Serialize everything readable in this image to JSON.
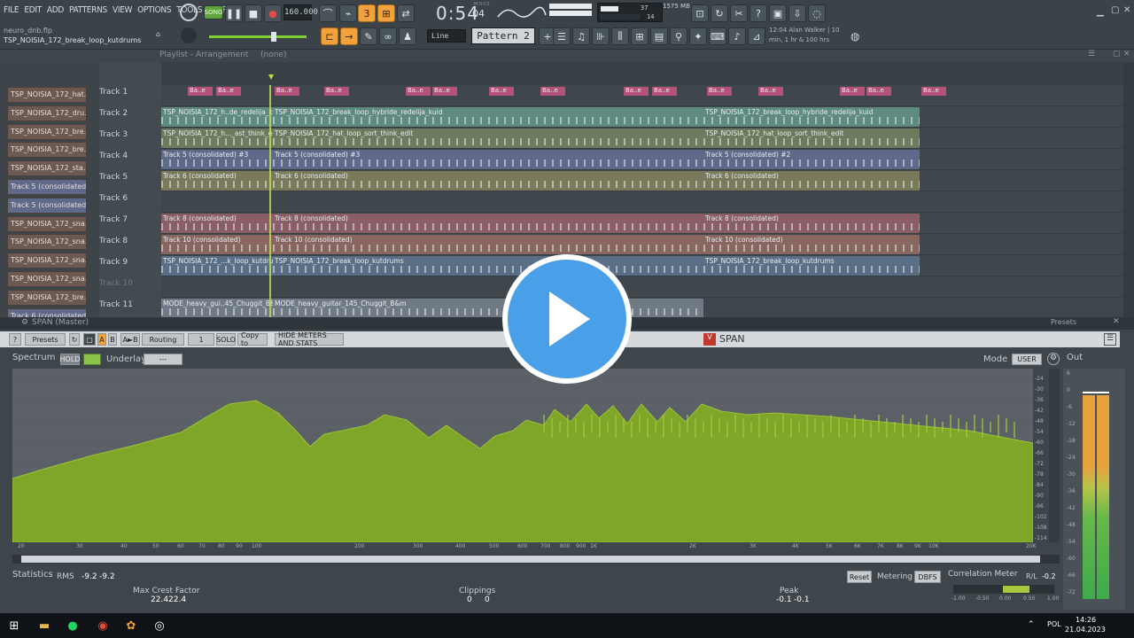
{
  "menu": [
    "FILE",
    "EDIT",
    "ADD",
    "PATTERNS",
    "VIEW",
    "OPTIONS",
    "TOOLS",
    "HELP"
  ],
  "transport": {
    "mode": "SONG",
    "tempo": "160.000",
    "time": "0:54",
    "time_sub": "04",
    "time_unit": "M:S:CS",
    "cpu": "37",
    "mem": "1575 MB",
    "voices": "14"
  },
  "project": {
    "file": "neuro_dnb.flp",
    "pattern_name": "TSP_NOISIA_172_break_loop_kutdrums",
    "snap": "Line",
    "pattern": "Pattern 2"
  },
  "hint": {
    "line1": "12:04  Alan Walker | 10",
    "line2": "min, 1 hr & 100 hrs"
  },
  "playlist": {
    "title": "Playlist - Arrangement",
    "arrangement": "(none)",
    "patterns": [
      "TSP_NOISIA_172_hat..",
      "TSP_NOISIA_172_dru..",
      "TSP_NOISIA_172_bre..",
      "TSP_NOISIA_172_bre..",
      "TSP_NOISIA_172_sta..",
      "Track 5 (consolidated)",
      "Track 5 (consolidated)",
      "TSP_NOISIA_172_sna..",
      "TSP_NOISIA_172_sna..",
      "TSP_NOISIA_172_sna..",
      "TSP_NOISIA_172_sna..",
      "TSP_NOISIA_172_bre..",
      "Track 6 (consolidated)"
    ],
    "tracks": [
      "Track 1",
      "Track 2",
      "Track 3",
      "Track 4",
      "Track 5",
      "Track 6",
      "Track 7",
      "Track 8",
      "Track 9",
      "Track 10",
      "Track 11"
    ],
    "clips": {
      "t1": "Ba..e",
      "t2": [
        "TSP_NOISIA_172_h..de_redelija_kuid",
        "TSP_NOISIA_172_break_loop_hybride_redelija_kuid",
        "TSP_NOISIA_172_break_loop_hybride_redelija_kuid"
      ],
      "t3": [
        "TSP_NOISIA_172_h..._ast_think_edit",
        "TSP_NOISIA_172_hat_loop_sort_think_edit",
        "TSP_NOISIA_172_hat_loop_sort_think_edit"
      ],
      "t4": [
        "Track 5 (consolidated) #3",
        "Track 5 (consolidated) #3",
        "Track 5 (consolidated) #2"
      ],
      "t5": [
        "Track 6 (consolidated)",
        "Track 6 (consolidated)",
        "Track 6 (consolidated)"
      ],
      "t7": [
        "Track 8 (consolidated)",
        "Track 8 (consolidated)",
        "Track 8 (consolidated)"
      ],
      "t8": [
        "Track 10 (consolidated)",
        "Track 10 (consolidated)",
        "Track 10 (consolidated)"
      ],
      "t9": [
        "TSP_NOISIA_172_...k_loop_kutdrums",
        "TSP_NOISIA_172_break_loop_kutdrums",
        "TSP_NOISIA_172_break_loop_kutdrums"
      ],
      "t11": [
        "MODE_heavy_gui..45_Chuggit_B&m",
        "MODE_heavy_guitar_145_Chuggit_B&m"
      ]
    }
  },
  "span": {
    "window_title": "SPAN (Master)",
    "presets": "Presets",
    "routing": "Routing",
    "channel": "1",
    "solo": "SOLO",
    "copy_to": "Copy to",
    "hide_meters": "HIDE METERS AND STATS",
    "logo": "SPAN",
    "spectrum": "Spectrum",
    "hold": "HOLD",
    "underlay": "Underlay",
    "underlay_value": "---",
    "mode": "Mode",
    "mode_value": "USER",
    "out": "Out",
    "db_ticks": [
      "-24",
      "-30",
      "-36",
      "-42",
      "-48",
      "-54",
      "-60",
      "-66",
      "-72",
      "-78",
      "-84",
      "-90",
      "-96",
      "-102",
      "-108",
      "-114"
    ],
    "freq_ticks": [
      "20",
      "30",
      "40",
      "50",
      "60",
      "70",
      "80",
      "90",
      "100",
      "200",
      "300",
      "400",
      "500",
      "600",
      "700",
      "800",
      "900",
      "1K",
      "2K",
      "3K",
      "4K",
      "5K",
      "6K",
      "7K",
      "8K",
      "9K",
      "10K",
      "20K"
    ],
    "out_ticks": [
      "6",
      "0",
      "-6",
      "-12",
      "-18",
      "-24",
      "-30",
      "-36",
      "-42",
      "-48",
      "-54",
      "-60",
      "-66",
      "-72"
    ],
    "statistics": "Statistics",
    "rms_label": "RMS",
    "rms_l": "-9.2",
    "rms_r": "-9.2",
    "crest_label": "Max Crest Factor",
    "crest_l": "22.4",
    "crest_r": "22.4",
    "clip_label": "Clippings",
    "clip_l": "0",
    "clip_r": "0",
    "peak_label": "Peak",
    "peak_l": "-0.1",
    "peak_r": "-0.1",
    "reset": "Reset",
    "metering": "Metering",
    "dbfs": "DBFS",
    "corr_label": "Correlation Meter",
    "rl": "R/L",
    "corr_value": "-0.2",
    "corr_ticks": [
      "-1.00",
      "-0.50",
      "0.00",
      "0.50",
      "1.00"
    ]
  },
  "taskbar": {
    "lang": "POL",
    "time": "14:26",
    "date": "21.04.2023"
  },
  "colors": {
    "spectrum_fill": "#7fa628",
    "accent_orange": "#f2a23c",
    "play_blue": "#4aa0e8"
  }
}
